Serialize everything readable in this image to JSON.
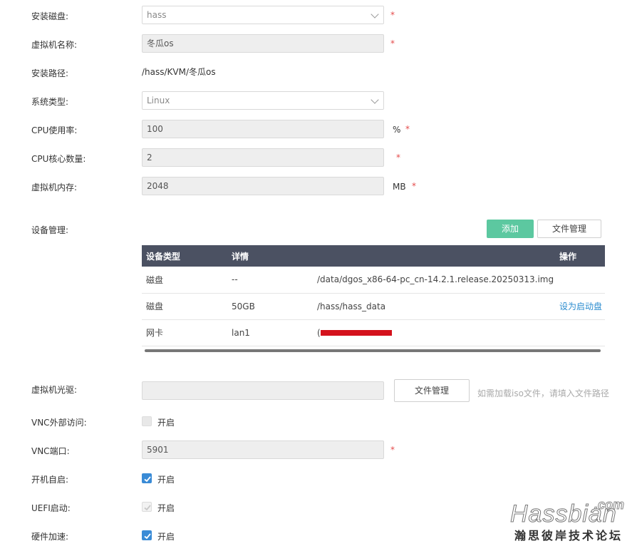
{
  "form": {
    "install_disk": {
      "label": "安装磁盘:",
      "value": "hass",
      "required": "*"
    },
    "vm_name": {
      "label": "虚拟机名称:",
      "value": "冬瓜os",
      "required": "*"
    },
    "install_path": {
      "label": "安装路径:",
      "value": "/hass/KVM/冬瓜os"
    },
    "system_type": {
      "label": "系统类型:",
      "value": "Linux"
    },
    "cpu_usage": {
      "label": "CPU使用率:",
      "value": "100",
      "unit": "%",
      "required": "*"
    },
    "cpu_cores": {
      "label": "CPU核心数量:",
      "value": "2",
      "required": "*"
    },
    "vm_memory": {
      "label": "虚拟机内存:",
      "value": "2048",
      "unit": "MB",
      "required": "*"
    }
  },
  "devices": {
    "label": "设备管理:",
    "add_button": "添加",
    "file_button": "文件管理",
    "columns": {
      "type": "设备类型",
      "details": "详情",
      "path": "",
      "action": "操作"
    },
    "rows": [
      {
        "type": "磁盘",
        "details": "--",
        "path": "/data/dgos_x86-64-pc_cn-14.2.1.release.20250313.img",
        "action": ""
      },
      {
        "type": "磁盘",
        "details": "50GB",
        "path": "/hass/hass_data",
        "action": "设为启动盘"
      },
      {
        "type": "网卡",
        "details": "lan1",
        "path": "(",
        "action": ""
      }
    ]
  },
  "cdrom": {
    "label": "虚拟机光驱:",
    "value": "",
    "file_button": "文件管理",
    "hint": "如需加载iso文件，请填入文件路径"
  },
  "vnc_external": {
    "label": "VNC外部访问:",
    "option": "开启",
    "checked": false
  },
  "vnc_port": {
    "label": "VNC端口:",
    "value": "5901",
    "required": "*"
  },
  "autostart": {
    "label": "开机自启:",
    "option": "开启",
    "checked": true
  },
  "uefi": {
    "label": "UEFI启动:",
    "option": "开启",
    "checked": true,
    "disabled": true
  },
  "hw_accel": {
    "label": "硬件加速:",
    "option": "开启",
    "checked": true
  },
  "watermark": {
    "dot": ".com",
    "brand": "Hassbian",
    "cn": "瀚思彼岸技术论坛"
  }
}
